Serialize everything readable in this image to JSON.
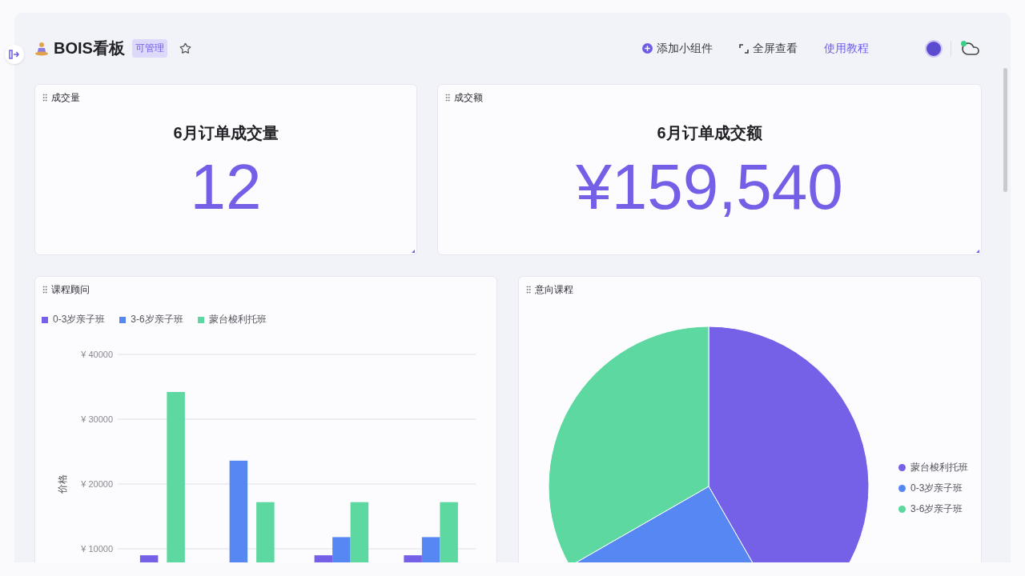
{
  "header": {
    "title": "BOIS看板",
    "badge": "可管理",
    "starred": false,
    "sync_online": true,
    "actions": [
      {
        "kind": "add",
        "label": "添加小组件"
      },
      {
        "kind": "fullscreen",
        "label": "全屏查看"
      },
      {
        "kind": "link",
        "label": "使用教程"
      }
    ]
  },
  "widgets": [
    {
      "kind": "stat",
      "name": "成交量",
      "heading": "6月订单成交量",
      "value": "12"
    },
    {
      "kind": "stat",
      "name": "成交额",
      "heading": "6月订单成交额",
      "value": "¥159,540"
    },
    {
      "kind": "chart",
      "name": "课程顾问",
      "chart_data": {
        "type": "bar",
        "ylabel": "价格",
        "ylim": [
          0,
          40000
        ],
        "grid": true,
        "yticks": [
          {
            "value": 10000,
            "label": "¥ 10000"
          },
          {
            "value": 20000,
            "label": "¥ 20000"
          },
          {
            "value": 30000,
            "label": "¥ 30000"
          },
          {
            "value": 40000,
            "label": "¥ 40000"
          }
        ],
        "series": [
          {
            "name": "0-3岁亲子班",
            "color": "#7561e8",
            "values": [
              9000,
              null,
              9000,
              9000
            ]
          },
          {
            "name": "3-6岁亲子班",
            "color": "#5687f2",
            "values": [
              null,
              23600,
              11800,
              11800
            ]
          },
          {
            "name": "蒙台梭利托班",
            "color": "#5dd8a0",
            "values": [
              34200,
              17200,
              17200,
              17200
            ]
          }
        ]
      }
    },
    {
      "kind": "chart",
      "name": "意向课程",
      "chart_data": {
        "type": "pie",
        "categories": [
          "蒙台梭利托班",
          "0-3岁亲子班",
          "3-6岁亲子班"
        ],
        "values": [
          41.7,
          25,
          33.3
        ],
        "colors": [
          "#7561e8",
          "#5687f2",
          "#5dd8a0"
        ]
      }
    }
  ]
}
